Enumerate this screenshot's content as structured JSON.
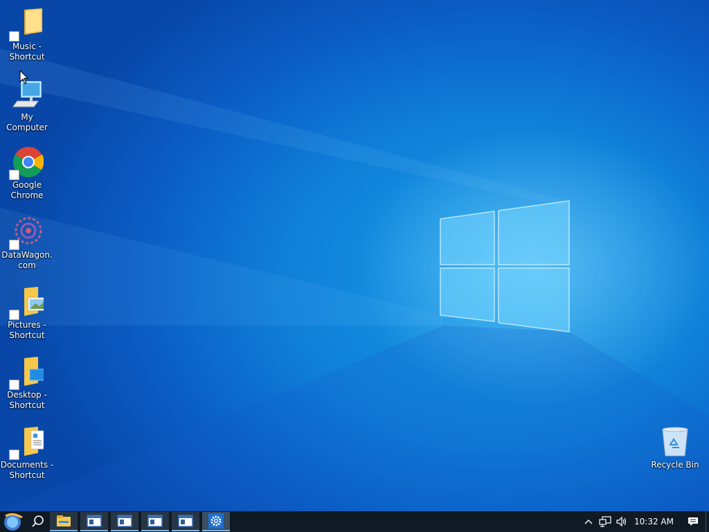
{
  "desktop": {
    "icons": [
      {
        "label": "Music - Shortcut",
        "icon": "music-folder-icon"
      },
      {
        "label": "My Computer",
        "icon": "computer-icon"
      },
      {
        "label": "Google Chrome",
        "icon": "chrome-icon"
      },
      {
        "label": "DataWagon.com",
        "icon": "datawagon-icon"
      },
      {
        "label": "Pictures - Shortcut",
        "icon": "pictures-folder-icon"
      },
      {
        "label": "Desktop - Shortcut",
        "icon": "desktop-folder-icon"
      },
      {
        "label": "Documents - Shortcut",
        "icon": "documents-folder-icon"
      },
      {
        "label": "Recycle Bin",
        "icon": "recycle-bin-icon"
      }
    ],
    "wallpaper_colors": {
      "deep": "#0847a8",
      "mid": "#0f7fd8",
      "glow": "#8cdcff"
    }
  },
  "taskbar": {
    "start_icon": "start-orb-icon",
    "search_icon": "search-icon",
    "apps": [
      {
        "icon": "file-explorer-icon"
      },
      {
        "icon": "window-icon"
      },
      {
        "icon": "window-icon"
      },
      {
        "icon": "window-icon"
      },
      {
        "icon": "window-icon"
      },
      {
        "icon": "settings-gear-icon"
      }
    ],
    "tray": {
      "chevron_icon": "chevron-up-icon",
      "network_icon": "network-icon",
      "volume_icon": "volume-icon",
      "time": "10:32 AM",
      "notification_icon": "action-center-icon"
    },
    "accent": "#7fb2e0"
  }
}
